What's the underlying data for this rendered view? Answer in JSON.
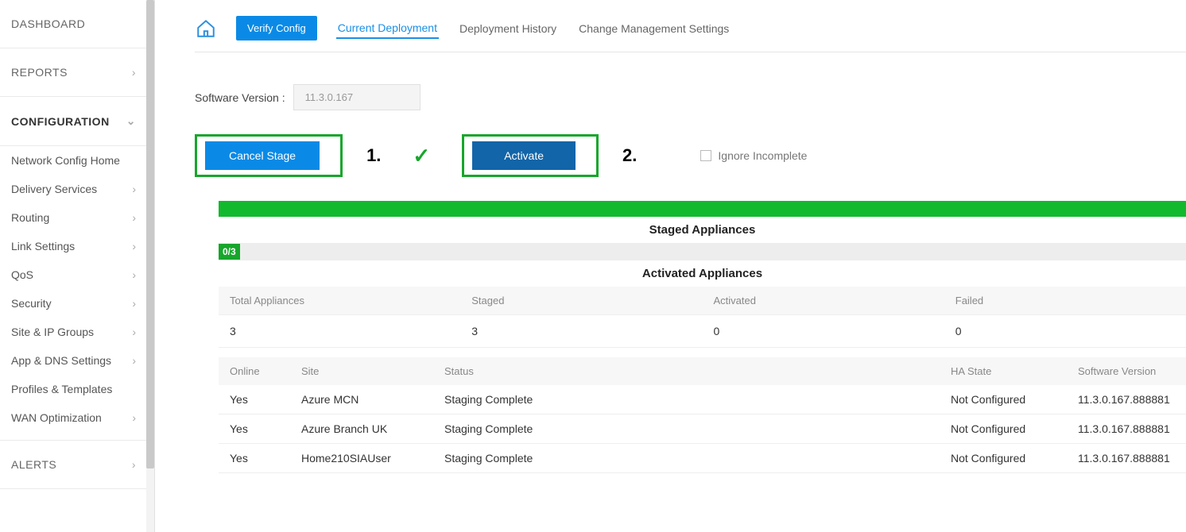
{
  "sidebar": {
    "dashboard": "DASHBOARD",
    "reports": "REPORTS",
    "configuration": "CONFIGURATION",
    "items": [
      "Network Config Home",
      "Delivery Services",
      "Routing",
      "Link Settings",
      "QoS",
      "Security",
      "Site & IP Groups",
      "App & DNS Settings",
      "Profiles & Templates",
      "WAN Optimization"
    ],
    "alerts": "ALERTS"
  },
  "tabs": {
    "verify": "Verify Config",
    "current": "Current Deployment",
    "history": "Deployment History",
    "settings": "Change Management Settings"
  },
  "software": {
    "label": "Software Version :",
    "value": "11.3.0.167"
  },
  "actions": {
    "cancel": "Cancel Stage",
    "activate": "Activate",
    "marker1": "1.",
    "marker2": "2.",
    "ignore": "Ignore Incomplete"
  },
  "sections": {
    "staged": "Staged Appliances",
    "activated": "Activated Appliances",
    "badge": "0/3"
  },
  "summary": {
    "headers": {
      "total": "Total Appliances",
      "staged": "Staged",
      "activated": "Activated",
      "failed": "Failed"
    },
    "values": {
      "total": "3",
      "staged": "3",
      "activated": "0",
      "failed": "0"
    }
  },
  "table": {
    "headers": {
      "online": "Online",
      "site": "Site",
      "status": "Status",
      "ha": "HA State",
      "sw": "Software Version"
    },
    "rows": [
      {
        "online": "Yes",
        "site": "Azure MCN",
        "status": "Staging Complete",
        "ha": "Not Configured",
        "sw": "11.3.0.167.888881"
      },
      {
        "online": "Yes",
        "site": "Azure Branch UK",
        "status": "Staging Complete",
        "ha": "Not Configured",
        "sw": "11.3.0.167.888881"
      },
      {
        "online": "Yes",
        "site": "Home210SIAUser",
        "status": "Staging Complete",
        "ha": "Not Configured",
        "sw": "11.3.0.167.888881"
      }
    ]
  }
}
